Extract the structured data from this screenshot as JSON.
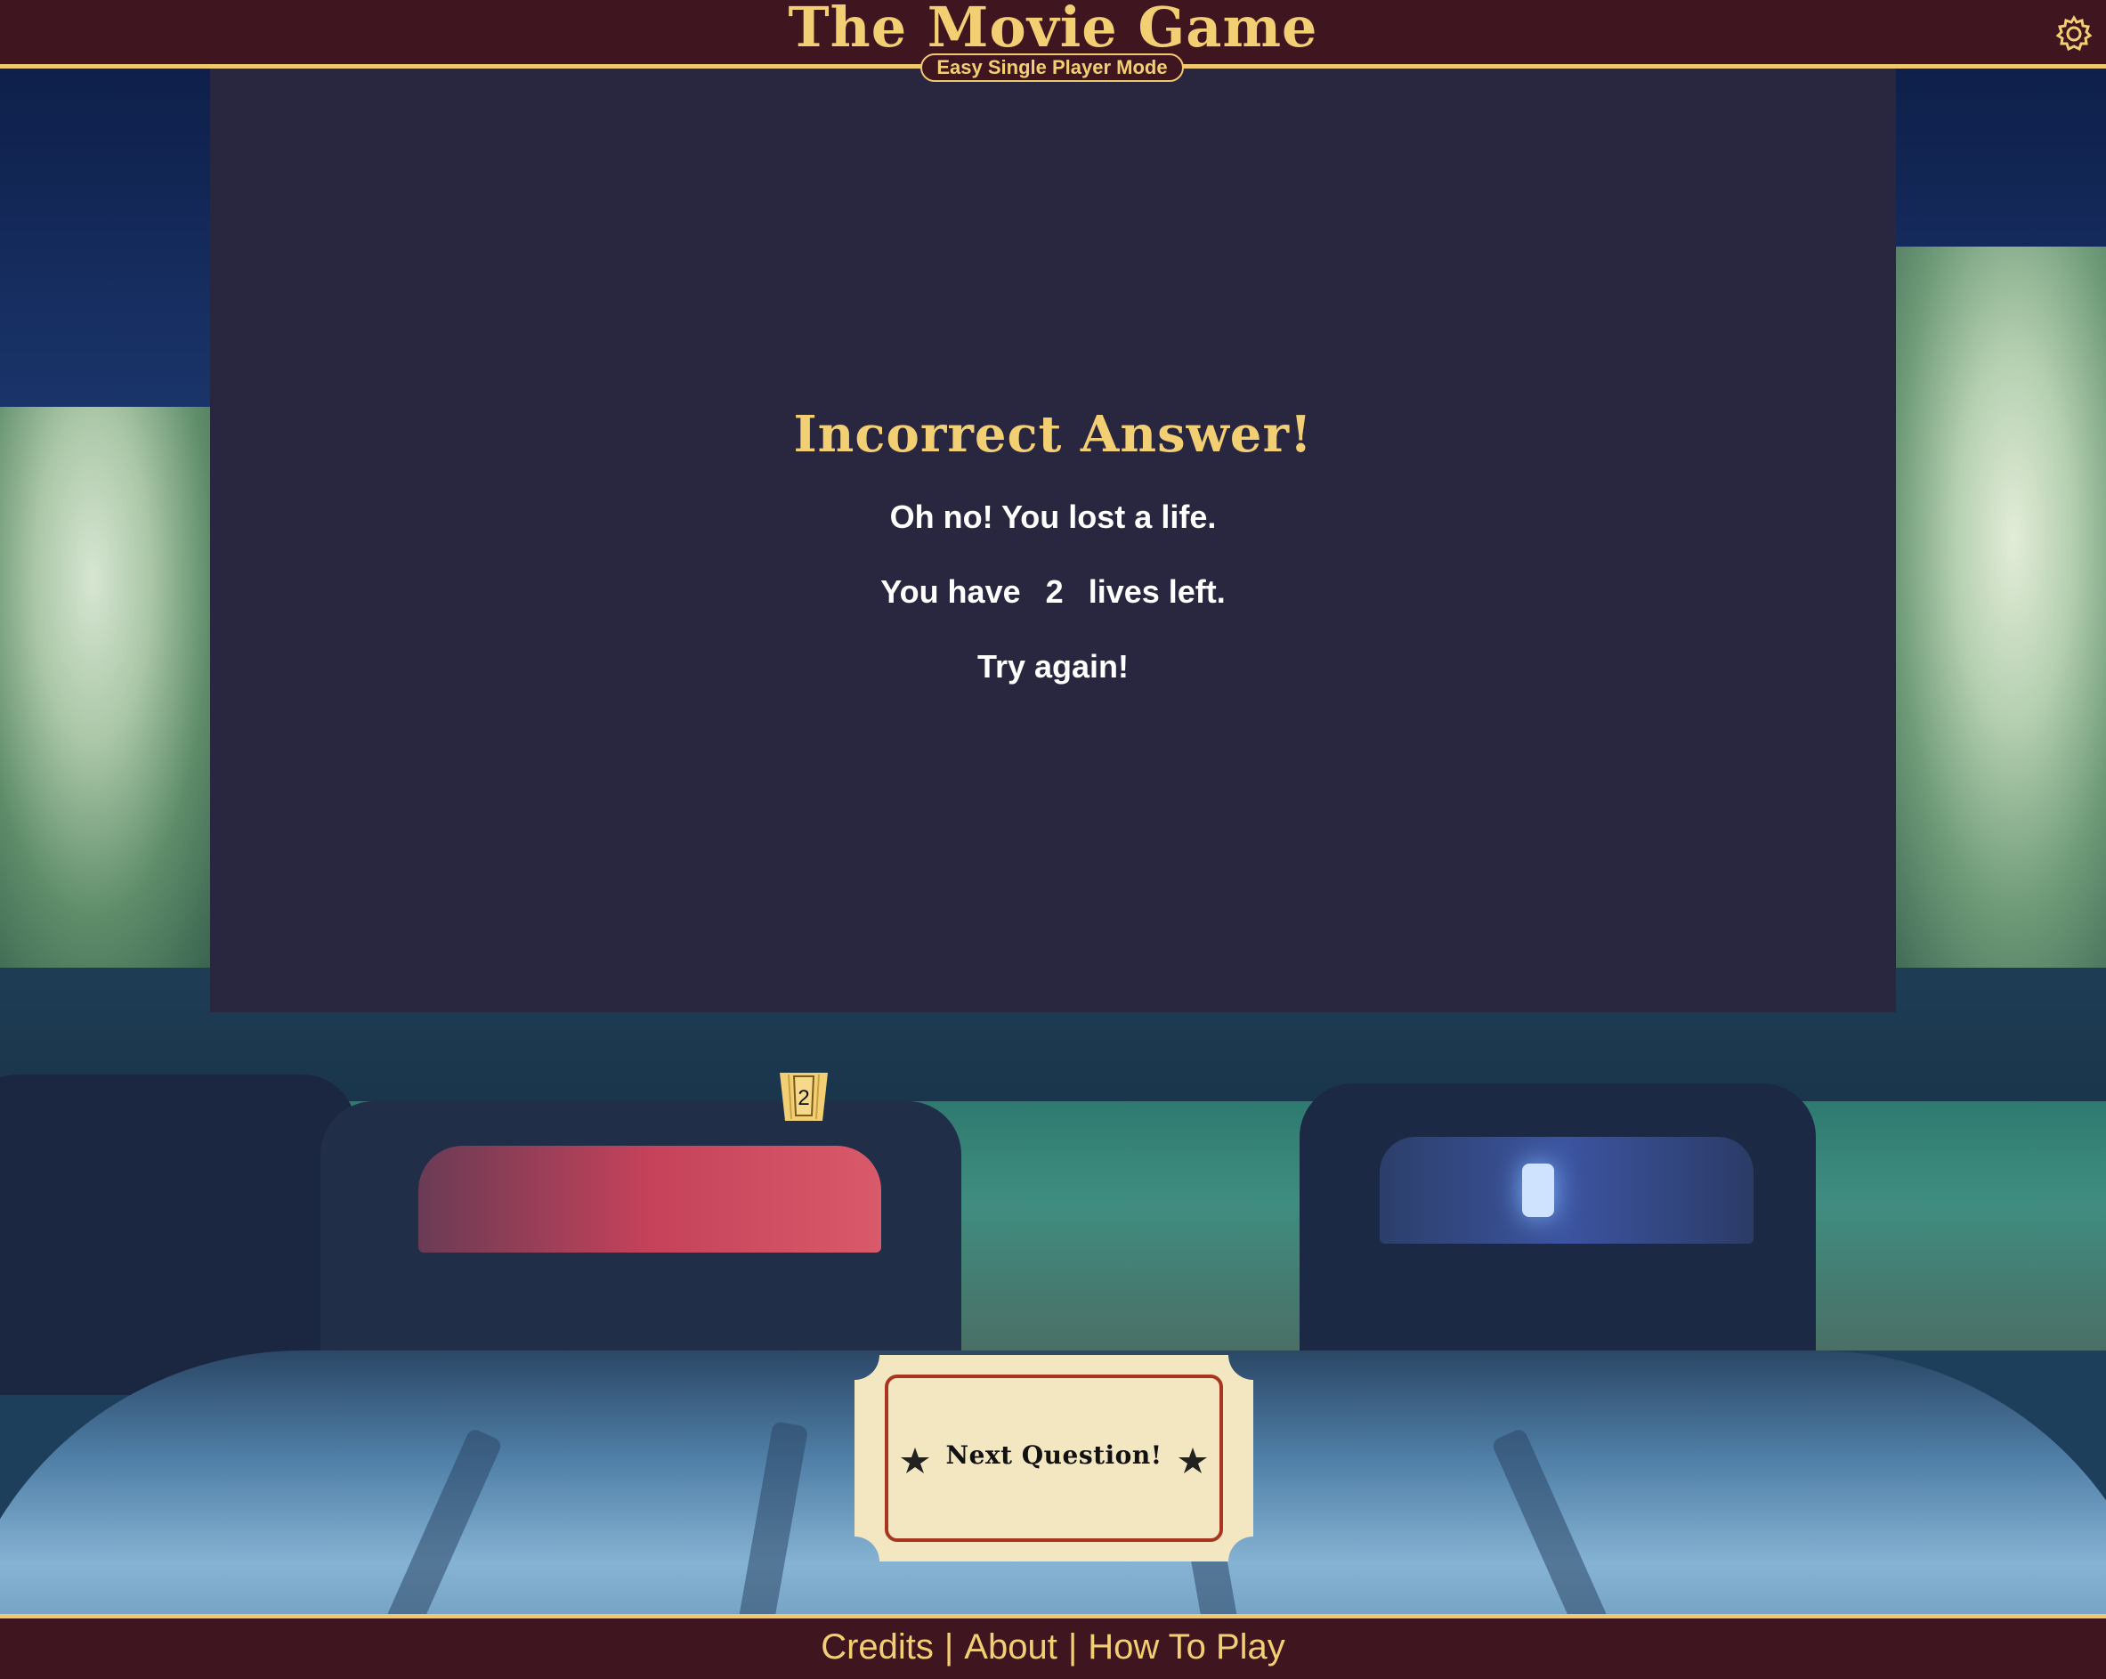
{
  "header": {
    "title": "The Movie Game",
    "mode": "Easy Single Player Mode",
    "settings_icon": "gear-icon"
  },
  "result": {
    "heading": "Incorrect Answer!",
    "line1": "Oh no! You lost a life.",
    "lives_prefix": "You have",
    "lives_count": "2",
    "lives_suffix": "lives left.",
    "line3": "Try again!"
  },
  "lives_badge": {
    "icon": "popcorn-icon",
    "value": "2"
  },
  "next_button": {
    "label": "Next Question!",
    "left_icon": "star-icon",
    "right_icon": "star-icon"
  },
  "footer": {
    "credits": "Credits",
    "about": "About",
    "how_to_play": "How To Play",
    "separator": "|"
  },
  "colors": {
    "header_bg": "#3f1520",
    "accent_gold": "#f3cf74",
    "screen_bg": "#292640",
    "ticket_bg": "#f2e7c1",
    "ticket_border": "#a8351f"
  }
}
